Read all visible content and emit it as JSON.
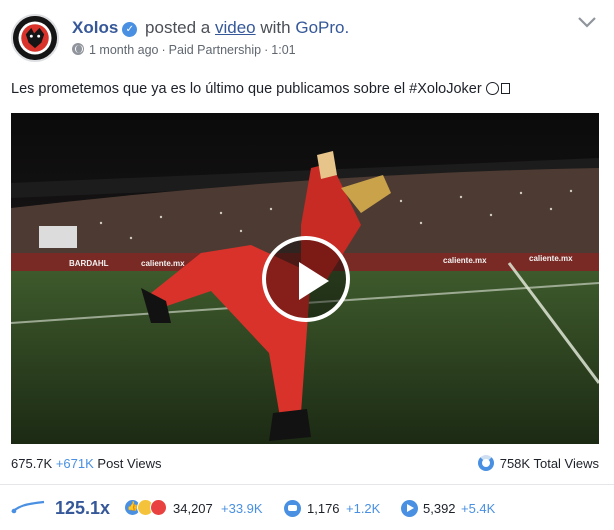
{
  "header": {
    "page_name": "Xolos",
    "posted_text": "posted a",
    "media_link": "video",
    "with_text": "with",
    "partner_link": "GoPro.",
    "age": "1 month ago",
    "sponsorship": "Paid Partnership",
    "duration": "1:01"
  },
  "caption": {
    "text": "Les prometemos que ya es lo último que publicamos sobre el #XoloJoker"
  },
  "video": {
    "banners": [
      "BARDAHL",
      "caliente.mx",
      "caliente.mx",
      "caliente.mx"
    ]
  },
  "views": {
    "post_views": "675.7K",
    "post_views_delta": "+671K",
    "post_views_label": "Post Views",
    "total_views": "758K",
    "total_views_label": "Total Views",
    "total_views_fraction": 0.89
  },
  "stats": {
    "multiplier": "125.1x",
    "reactions": "34,207",
    "reactions_delta": "+33.9K",
    "comments": "1,176",
    "comments_delta": "+1.2K",
    "shares": "5,392",
    "shares_delta": "+5.4K"
  },
  "colors": {
    "link": "#365899",
    "accent": "#4a90e2",
    "mascot_red": "#d8322a"
  },
  "icons": [
    "globe-icon",
    "verified-icon",
    "chevron-down-icon",
    "play-icon",
    "views-donut-icon",
    "trend-icon",
    "like-icon",
    "haha-icon",
    "love-icon",
    "comment-icon",
    "share-icon"
  ]
}
